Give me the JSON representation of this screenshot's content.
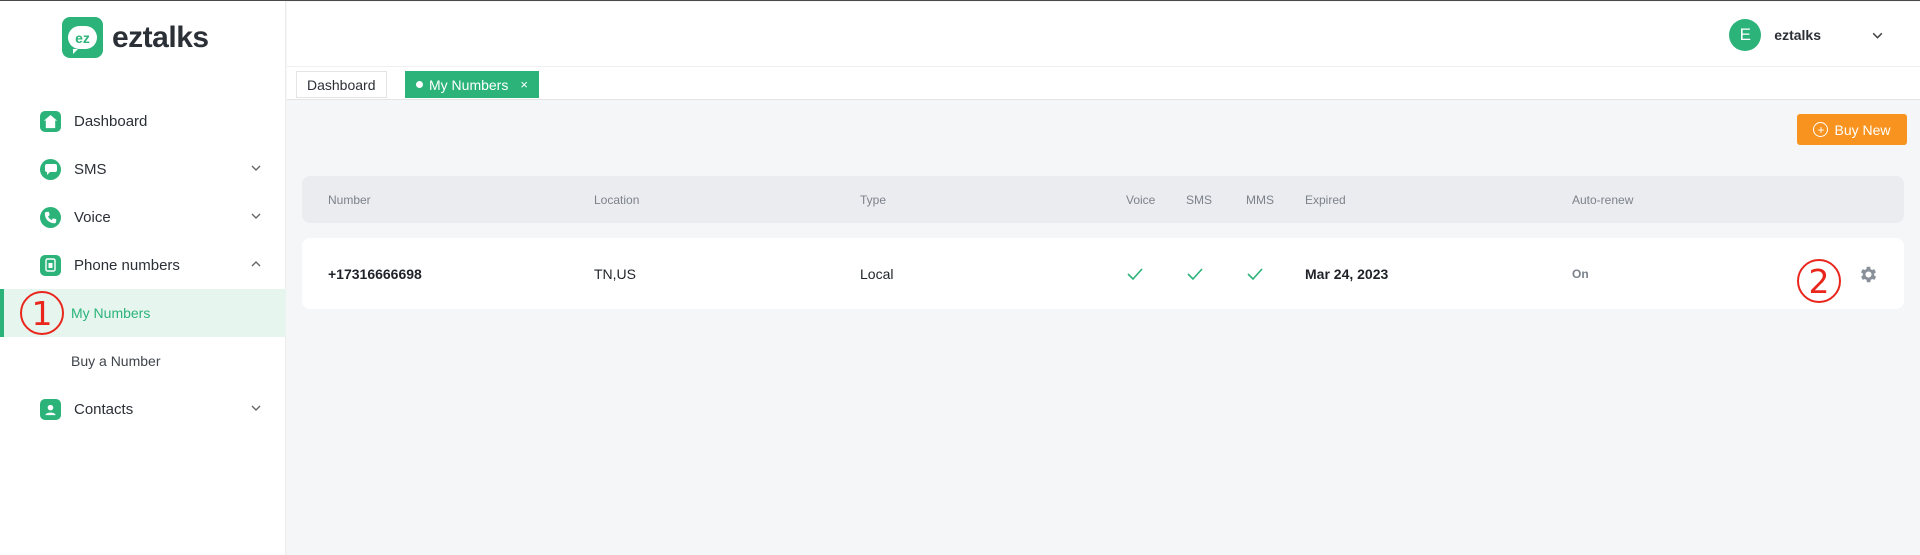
{
  "brand": {
    "name": "eztalks",
    "mark": "ez"
  },
  "colors": {
    "accent": "#2bb37a",
    "button": "#f7931e",
    "marker": "#e8261c"
  },
  "sidebar": {
    "items": [
      {
        "label": "Dashboard",
        "icon": "home-icon"
      },
      {
        "label": "SMS",
        "icon": "chat-icon",
        "chevron": "down"
      },
      {
        "label": "Voice",
        "icon": "phone-icon",
        "chevron": "down"
      },
      {
        "label": "Phone numbers",
        "icon": "sim-card-icon",
        "chevron": "up"
      },
      {
        "label": "Contacts",
        "icon": "contact-icon",
        "chevron": "down"
      }
    ],
    "sub_items": [
      {
        "label": "My Numbers",
        "active": true
      },
      {
        "label": "Buy a Number",
        "active": false
      }
    ]
  },
  "user": {
    "initial": "E",
    "name": "eztalks"
  },
  "tabs": [
    {
      "label": "Dashboard",
      "active": false
    },
    {
      "label": "My Numbers",
      "active": true,
      "close": "×"
    }
  ],
  "buy_button": {
    "label": "Buy New",
    "icon_glyph": "+"
  },
  "table": {
    "headers": [
      "Number",
      "Location",
      "Type",
      "Voice",
      "SMS",
      "MMS",
      "Expired",
      "Auto-renew"
    ],
    "rows": [
      {
        "number": "+17316666698",
        "location": "TN,US",
        "type": "Local",
        "voice": true,
        "sms": true,
        "mms": true,
        "expired": "Mar 24, 2023",
        "auto_renew": "On"
      }
    ]
  },
  "markers": [
    "1",
    "2"
  ]
}
